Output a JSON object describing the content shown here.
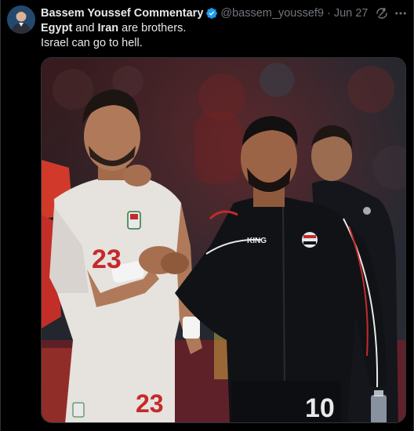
{
  "tweet": {
    "author_name": "Bassem Youssef Commentary",
    "handle": "@bassem_youssef9",
    "separator": "·",
    "date": "Jun 27",
    "line1": {
      "part1": "Egypt",
      "part2": " and ",
      "part3": "Iran",
      "part4": " are brothers."
    },
    "line2": "Israel can go to hell."
  },
  "photo": {
    "left_player_number": "23",
    "right_player_number": "10",
    "right_player_brand": "KING"
  },
  "icons": {
    "verified": "verified-badge-icon",
    "grok": "grok-icon",
    "more": "more-icon"
  },
  "colors": {
    "background": "#000000",
    "text": "#e7e9ea",
    "secondary": "#71767b",
    "verified": "#1d9bf0"
  }
}
